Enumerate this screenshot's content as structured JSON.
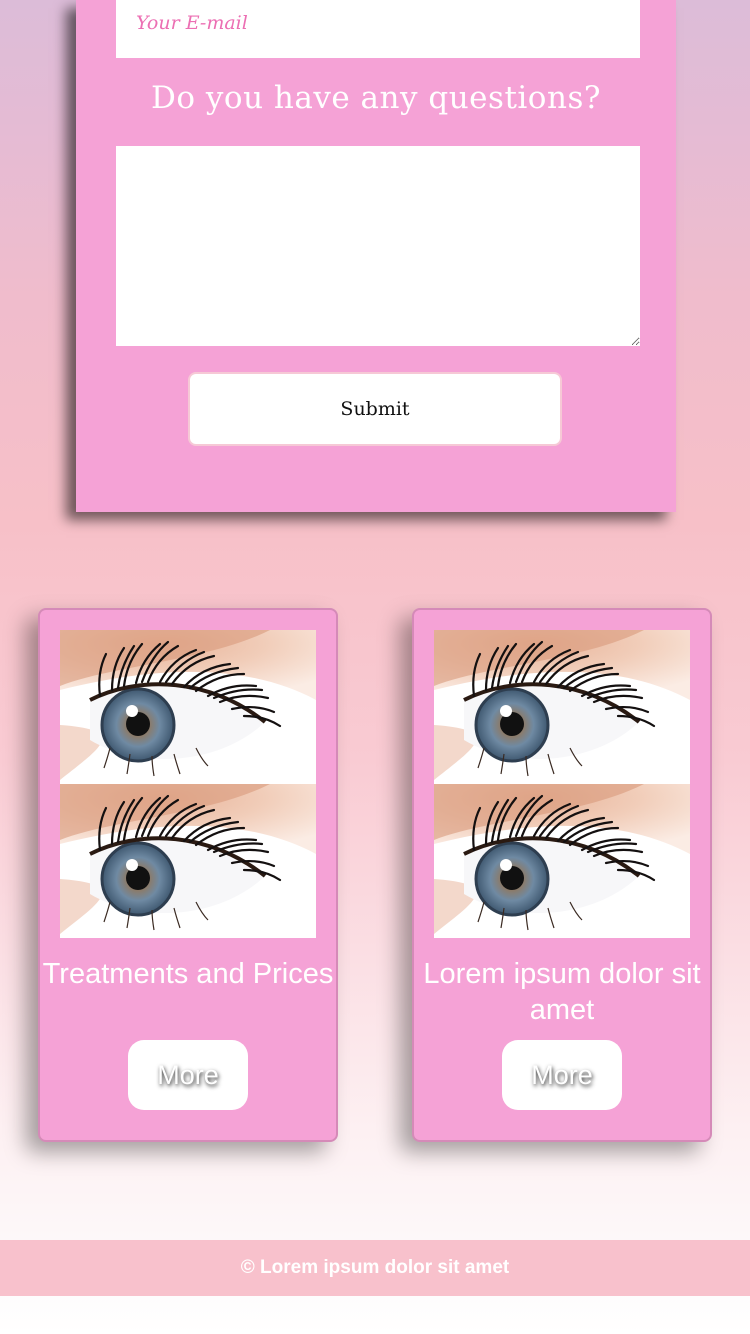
{
  "contact_form": {
    "email_placeholder": "Your E-mail",
    "question_heading": "Do you have any questions?",
    "question_value": "",
    "submit_label": "Submit"
  },
  "cards": [
    {
      "image_icon": "eyelash-eye-photo",
      "title": "Treatments and Prices",
      "button_label": "More"
    },
    {
      "image_icon": "eyelash-eye-photo",
      "title": "Lorem ipsum dolor sit amet",
      "button_label": "More"
    }
  ],
  "footer": {
    "copyright": "© Lorem ipsum dolor sit amet"
  },
  "colors": {
    "panel": "#f5a2d6",
    "footer": "#f8c1cc",
    "placeholder": "#ec6fb3"
  }
}
